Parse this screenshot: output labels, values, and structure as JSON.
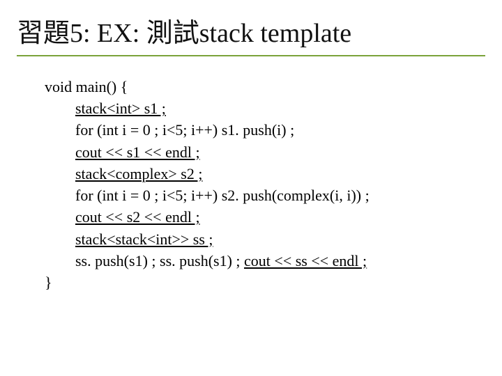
{
  "title": "習題5: EX: 測試stack template",
  "code": {
    "l1": "void main() {",
    "l2_u": "stack<int> s1 ;",
    "l3": "for (int i = 0 ; i<5; i++) s1. push(i) ;",
    "l4_u": "cout << s1 << endl ;",
    "l5_u": "stack<complex> s2 ;",
    "l6": "for (int i = 0 ; i<5; i++) s2. push(complex(i, i)) ;",
    "l7_u": "cout << s2 << endl ;",
    "l8_u": "stack<stack<int>> ss ;",
    "l9a": "ss. push(s1) ; ss. push(s1) ; ",
    "l9b_u": "cout << ss << endl ;",
    "l10": "}"
  }
}
